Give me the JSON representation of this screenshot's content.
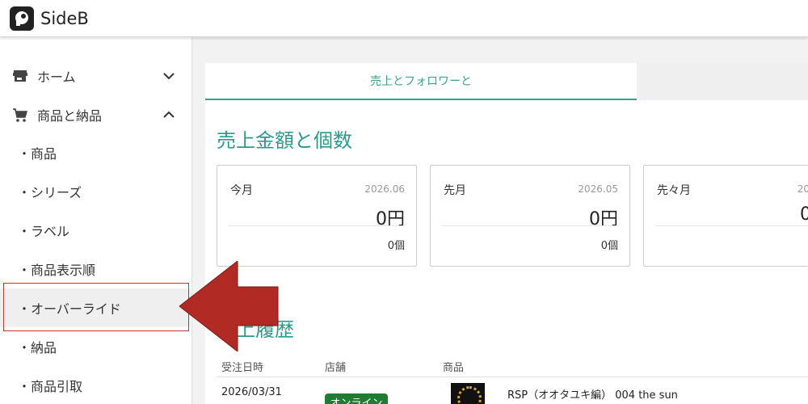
{
  "header": {
    "brand": "SideB"
  },
  "sidebar": {
    "items": [
      {
        "label": "ホーム",
        "icon": "store-icon",
        "chevron": "chevron-down-icon"
      },
      {
        "label": "商品と納品",
        "icon": "cart-icon",
        "chevron": "chevron-up-icon"
      }
    ],
    "subitems": [
      "・商品",
      "・シリーズ",
      "・ラベル",
      "・商品表示順",
      "・オーバーライド",
      "・納品",
      "・商品引取"
    ]
  },
  "tabs": {
    "active": "売上とフォロワーと"
  },
  "sales": {
    "title": "売上金額と個数",
    "cards": [
      {
        "label": "今月",
        "date": "2026.06",
        "amount": "0円",
        "count": "0個"
      },
      {
        "label": "先月",
        "date": "2026.05",
        "amount": "0円",
        "count": "0個"
      },
      {
        "label": "先々月",
        "date": "20",
        "amount": "0",
        "count": ""
      }
    ]
  },
  "history": {
    "title": "上履歴",
    "columns": [
      "受注日時",
      "店舗",
      "商品"
    ],
    "row": {
      "date": "2026/03/31",
      "store": "オンライン",
      "product": "RSP（オオタユキ編） 004 the sun"
    }
  },
  "colors": {
    "accent": "#2a9a8c",
    "arrow": "#b22a24",
    "badge": "#1e7d32"
  }
}
